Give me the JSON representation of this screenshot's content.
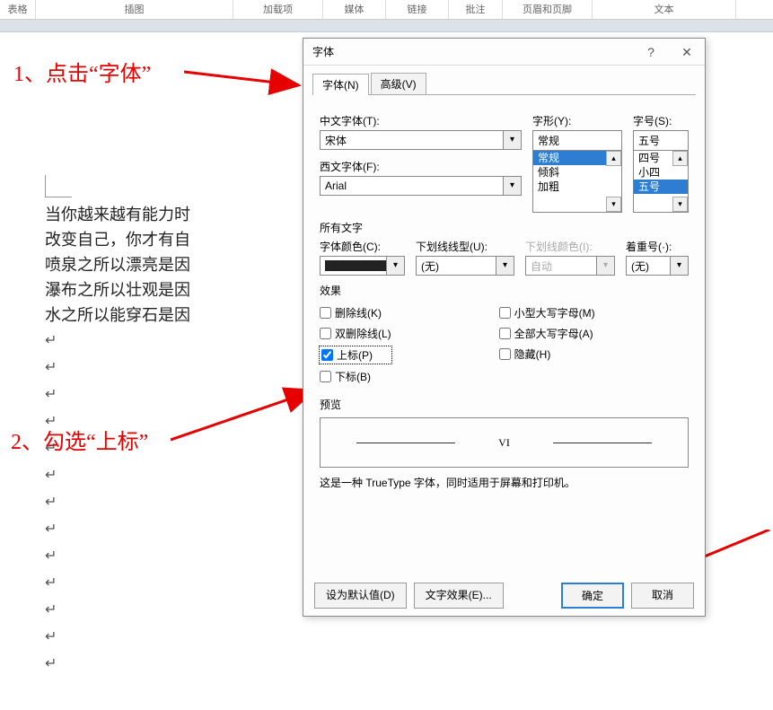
{
  "ribbon": {
    "groups": [
      "表格",
      "插图",
      "加载项",
      "媒体",
      "链接",
      "批注",
      "页眉和页脚",
      "文本"
    ]
  },
  "annotations": {
    "a1": "1、点击“字体”",
    "a2": "2、勾选“上标”"
  },
  "document": {
    "lines": [
      "当你越来越有能力时",
      "改变自己，你才有自",
      "喷泉之所以漂亮是因",
      "瀑布之所以壮观是因",
      "水之所以能穿石是因"
    ]
  },
  "dialog": {
    "title": "字体",
    "help": "?",
    "close": "✕",
    "tabs": {
      "font": "字体(N)",
      "advanced": "高级(V)"
    },
    "labels": {
      "cjk": "中文字体(T):",
      "latin": "西文字体(F):",
      "style": "字形(Y):",
      "size": "字号(S):",
      "all_text": "所有文字",
      "color": "字体颜色(C):",
      "underline": "下划线线型(U):",
      "ulcolor": "下划线颜色(I):",
      "emphasis": "着重号(·):",
      "effects": "效果",
      "preview": "预览",
      "footnote": "这是一种 TrueType 字体，同时适用于屏幕和打印机。"
    },
    "values": {
      "cjk": "宋体",
      "latin": "Arial",
      "style_selected": "常规",
      "style_list": [
        "常规",
        "倾斜",
        "加粗"
      ],
      "size_selected": "五号",
      "size_list": [
        "四号",
        "小四",
        "五号"
      ],
      "color": "",
      "underline": "(无)",
      "ulcolor": "自动",
      "emphasis": "(无)",
      "preview_text": "VI"
    },
    "effects_left": [
      {
        "key": "strike",
        "label": "删除线(K)",
        "checked": false
      },
      {
        "key": "dstrike",
        "label": "双删除线(L)",
        "checked": false
      },
      {
        "key": "sup",
        "label": "上标(P)",
        "checked": true
      },
      {
        "key": "sub",
        "label": "下标(B)",
        "checked": false
      }
    ],
    "effects_right": [
      {
        "key": "smallcaps",
        "label": "小型大写字母(M)",
        "checked": false
      },
      {
        "key": "allcaps",
        "label": "全部大写字母(A)",
        "checked": false
      },
      {
        "key": "hidden",
        "label": "隐藏(H)",
        "checked": false
      }
    ],
    "buttons": {
      "default": "设为默认值(D)",
      "texteffects": "文字效果(E)...",
      "ok": "确定",
      "cancel": "取消"
    }
  }
}
